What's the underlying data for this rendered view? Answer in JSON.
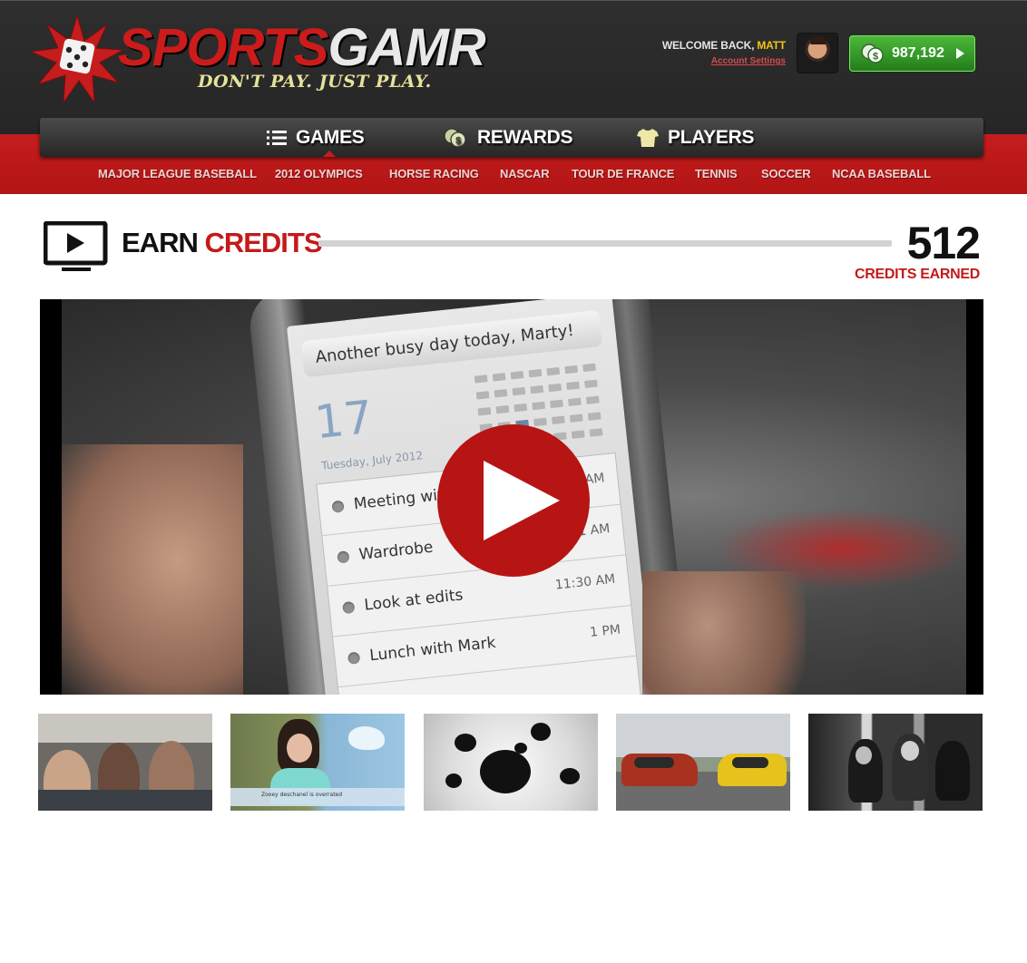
{
  "brand": {
    "name_red": "SPORTS",
    "name_white": "GAMR",
    "tagline": "DON'T PAY. JUST PLAY.",
    "accent_red": "#c31a1a",
    "tagline_color": "#e7e29a"
  },
  "user": {
    "welcome_prefix": "WELCOME BACK, ",
    "name": "MATT",
    "account_settings": "Account Settings",
    "credits_balance": "987,192"
  },
  "nav": {
    "main": [
      {
        "label": "GAMES",
        "icon": "list-icon",
        "active": true
      },
      {
        "label": "REWARDS",
        "icon": "coins-icon",
        "active": false
      },
      {
        "label": "PLAYERS",
        "icon": "jersey-icon",
        "active": false
      }
    ],
    "sub": [
      "MAJOR LEAGUE BASEBALL",
      "2012 OLYMPICS",
      "HORSE RACING",
      "NASCAR",
      "TOUR DE FRANCE",
      "TENNIS",
      "SOCCER",
      "NCAA BASEBALL"
    ]
  },
  "earn": {
    "title_black": "EARN",
    "title_red": "CREDITS",
    "credits_earned": "512",
    "credits_earned_label": "CREDITS EARNED",
    "icon": "tv-play-icon"
  },
  "video": {
    "notification": "Another busy day today, Marty!",
    "date_number": "17",
    "date_sub": "Tuesday, July 2012",
    "events": [
      {
        "title": "Meeting with Tom",
        "time": "10 AM"
      },
      {
        "title": "Wardrobe",
        "time": "11 AM"
      },
      {
        "title": "Look at edits",
        "time": "11:30 AM"
      },
      {
        "title": "Lunch with Mark",
        "time": "1 PM"
      }
    ]
  },
  "thumbnails": [
    {
      "caption": ""
    },
    {
      "caption": "Zooey deschanel is overrated"
    },
    {
      "caption": ""
    },
    {
      "caption": ""
    },
    {
      "caption": ""
    }
  ]
}
